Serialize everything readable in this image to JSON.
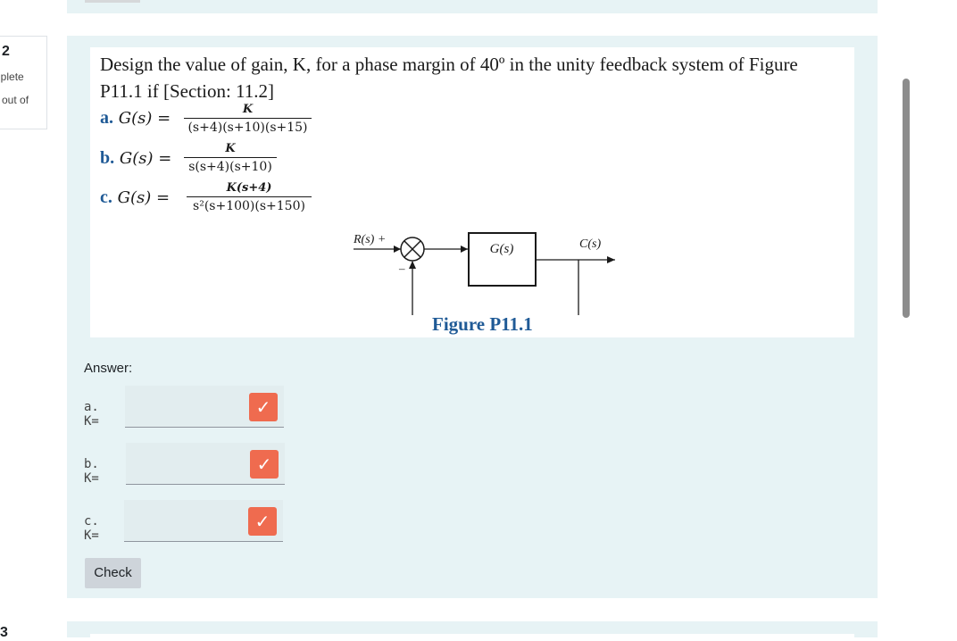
{
  "question": {
    "number": "2",
    "state": "nplete",
    "marks": "out of",
    "text_line1": "Design the value of gain, K, for a phase margin of 40º in the unity feedback system of Figure",
    "text_line2": "P11.1 if [Section: 11.2]",
    "parts": [
      {
        "label": "a.",
        "lhs": "G(s) =",
        "num": "K",
        "den": "(s+4)(s+10)(s+15)"
      },
      {
        "label": "b.",
        "lhs": "G(s) =",
        "num": "K",
        "den": "s(s+4)(s+10)"
      },
      {
        "label": "c.",
        "lhs": "G(s) =",
        "num": "K(s+4)",
        "den": "s²(s+100)(s+150)"
      }
    ],
    "figure": {
      "input": "R(s) +",
      "minus": "–",
      "block": "G(s)",
      "output": "C(s)",
      "caption": "Figure P11.1"
    }
  },
  "answer": {
    "label": "Answer:",
    "rows": [
      {
        "label": "a. K=",
        "value": "",
        "mark": "✓"
      },
      {
        "label": "b. K=",
        "value": "",
        "mark": "✓"
      },
      {
        "label": "c. K=",
        "value": "",
        "mark": "✓"
      }
    ],
    "check_label": "Check"
  },
  "next_question": {
    "number": "3"
  },
  "colors": {
    "accent": "#1f5a96",
    "mark": "#ef6b4f",
    "panel": "#e7f3f5"
  }
}
